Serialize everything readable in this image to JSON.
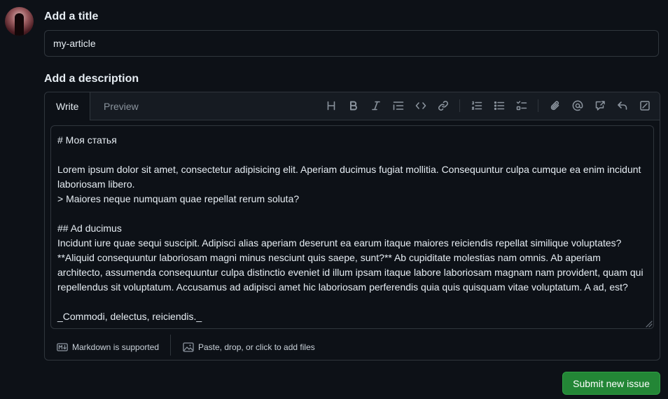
{
  "title_section": {
    "heading": "Add a title",
    "value": "my-article"
  },
  "description_section": {
    "heading": "Add a description",
    "tabs": [
      {
        "label": "Write",
        "active": true
      },
      {
        "label": "Preview",
        "active": false
      }
    ],
    "toolbar": [
      "heading-icon",
      "bold-icon",
      "italic-icon",
      "quote-icon",
      "code-icon",
      "link-icon",
      "ordered-list-icon",
      "unordered-list-icon",
      "task-list-icon",
      "attach-icon",
      "mention-icon",
      "cross-reference-icon",
      "saved-replies-icon",
      "fullscreen-icon"
    ],
    "body": "# Моя статья\n\nLorem ipsum dolor sit amet, consectetur adipisicing elit. Aperiam ducimus fugiat mollitia. Consequuntur culpa cumque ea enim incidunt laboriosam libero.\n> Maiores neque numquam quae repellat rerum soluta?\n\n## Ad ducimus\nIncidunt iure quae sequi suscipit. Adipisci alias aperiam deserunt ea earum itaque maiores reiciendis repellat similique voluptates? **Aliquid consequuntur laboriosam magni minus nesciunt quis saepe, sunt?** Ab cupiditate molestias nam omnis. Ab aperiam architecto, assumenda consequuntur culpa distinctio eveniet id illum ipsam itaque labore laboriosam magnam nam provident, quam qui repellendus sit voluptatum. Accusamus ad adipisci amet hic laboriosam perferendis quia quis quisquam vitae voluptatum. A ad, est?\n\n_Commodi, delectus, reiciendis._"
  },
  "footer": {
    "markdown_label": "Markdown is supported",
    "files_label": "Paste, drop, or click to add files"
  },
  "actions": {
    "submit_label": "Submit new issue"
  },
  "colors": {
    "background": "#0d1117",
    "border": "#30363d",
    "header_bg": "#161b22",
    "text": "#e6edf3",
    "muted": "#8b949e",
    "submit_bg": "#238636"
  }
}
